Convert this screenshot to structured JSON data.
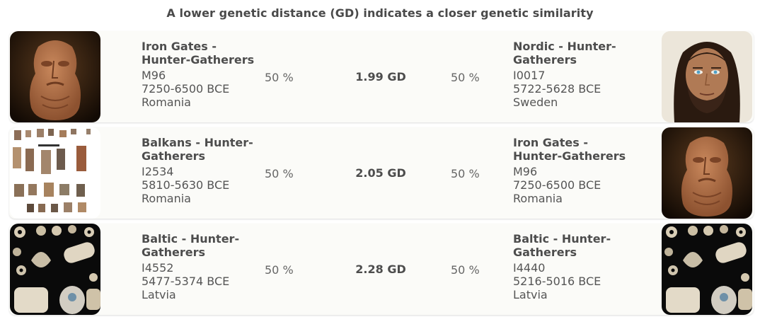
{
  "header": {
    "title": "A lower genetic distance (GD) indicates a closer genetic similarity"
  },
  "rows": [
    {
      "left": {
        "name": "Iron Gates - Hunter-Gatherers",
        "sample": "M96",
        "date": "7250-6500 BCE",
        "country": "Romania",
        "percent": "50 %",
        "image": "carved-stone-figure"
      },
      "gd": "1.99 GD",
      "right": {
        "name": "Nordic - Hunter-Gatherers",
        "sample": "I0017",
        "date": "5722-5628 BCE",
        "country": "Sweden",
        "percent": "50 %",
        "image": "face-reconstruction"
      }
    },
    {
      "left": {
        "name": "Balkans - Hunter-Gatherers",
        "sample": "I2534",
        "date": "5810-5630 BCE",
        "country": "Romania",
        "percent": "50 %",
        "image": "stone-tools-plate"
      },
      "gd": "2.05 GD",
      "right": {
        "name": "Iron Gates - Hunter-Gatherers",
        "sample": "M96",
        "date": "7250-6500 BCE",
        "country": "Romania",
        "percent": "50 %",
        "image": "carved-stone-figure"
      }
    },
    {
      "left": {
        "name": "Baltic - Hunter-Gatherers",
        "sample": "I4552",
        "date": "5477-5374 BCE",
        "country": "Latvia",
        "percent": "50 %",
        "image": "amber-beads"
      },
      "gd": "2.28 GD",
      "right": {
        "name": "Baltic - Hunter-Gatherers",
        "sample": "I4440",
        "date": "5216-5016 BCE",
        "country": "Latvia",
        "percent": "50 %",
        "image": "amber-beads"
      }
    }
  ]
}
